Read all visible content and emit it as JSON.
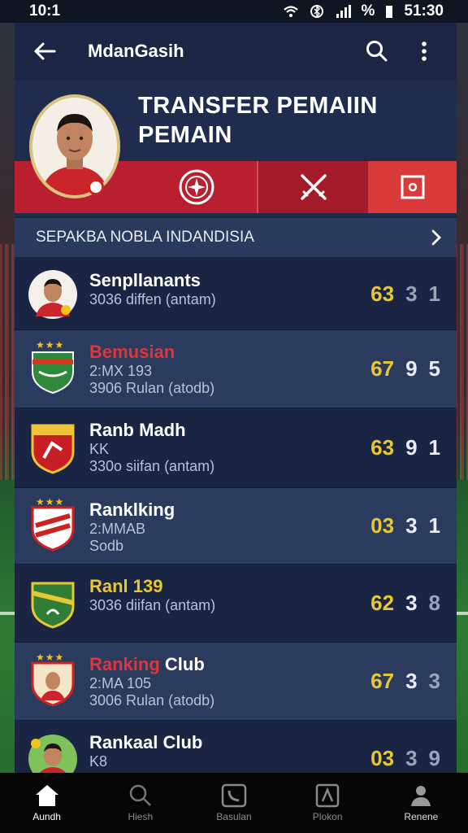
{
  "status_bar": {
    "time_left": "10:1",
    "time_right": "51:30"
  },
  "appbar": {
    "title": "MdanGasih"
  },
  "hero": {
    "heading_line1": "TRANSFER PEMAIIN",
    "heading_line2": "PEMAIN"
  },
  "section": {
    "label": "SEPAKBA NOBLA INDANDISIA"
  },
  "rows": [
    {
      "name": "Senpllanants",
      "name_red": "",
      "sub1": "3036 diffen (antam)",
      "sub2": "",
      "n1": "63",
      "n2": "3",
      "n3": "1",
      "style": "dark"
    },
    {
      "name": "",
      "name_red": "Bemusian",
      "sub1": "2:MX 193",
      "sub2": "3906 Rulan (atodb)",
      "n1": "67",
      "n2": "9",
      "n3": "5",
      "style": "light"
    },
    {
      "name": "Ranb Madh",
      "name_red": "",
      "sub1": "KK",
      "sub2": "330o siifan (antam)",
      "n1": "63",
      "n2": "9",
      "n3": "1",
      "style": "dark"
    },
    {
      "name": "Ranklking",
      "name_red": "",
      "sub1": "2:MMAB",
      "sub2": "Sodb",
      "n1": "03",
      "n2": "3",
      "n3": "1",
      "style": "light"
    },
    {
      "name": "Ranl 139",
      "name_red": "",
      "sub1": "3036 diifan (antam)",
      "sub2": "",
      "n1": "62",
      "n2": "3",
      "n3": "8",
      "style": "dark"
    },
    {
      "name": "Club",
      "name_red": "Ranking",
      "sub1": "2:MA 105",
      "sub2": "3006 Rulan (atodb)",
      "n1": "67",
      "n2": "3",
      "n3": "3",
      "style": "light"
    },
    {
      "name": "Rankaal Club",
      "name_red": "",
      "sub1": "K8",
      "sub2": "",
      "n1": "03",
      "n2": "3",
      "n3": "9",
      "style": "dark"
    }
  ],
  "nav": [
    {
      "label": "Aundh",
      "icon": "home-icon"
    },
    {
      "label": "Hiesh",
      "icon": "search-icon"
    },
    {
      "label": "Basulan",
      "icon": "phone-icon"
    },
    {
      "label": "Plokon",
      "icon": "profile-card-icon"
    },
    {
      "label": "Renene",
      "icon": "person-icon"
    }
  ],
  "colors": {
    "accent_red": "#b91f2e",
    "rating_yellow": "#e8c832",
    "panel": "#1a2540"
  }
}
